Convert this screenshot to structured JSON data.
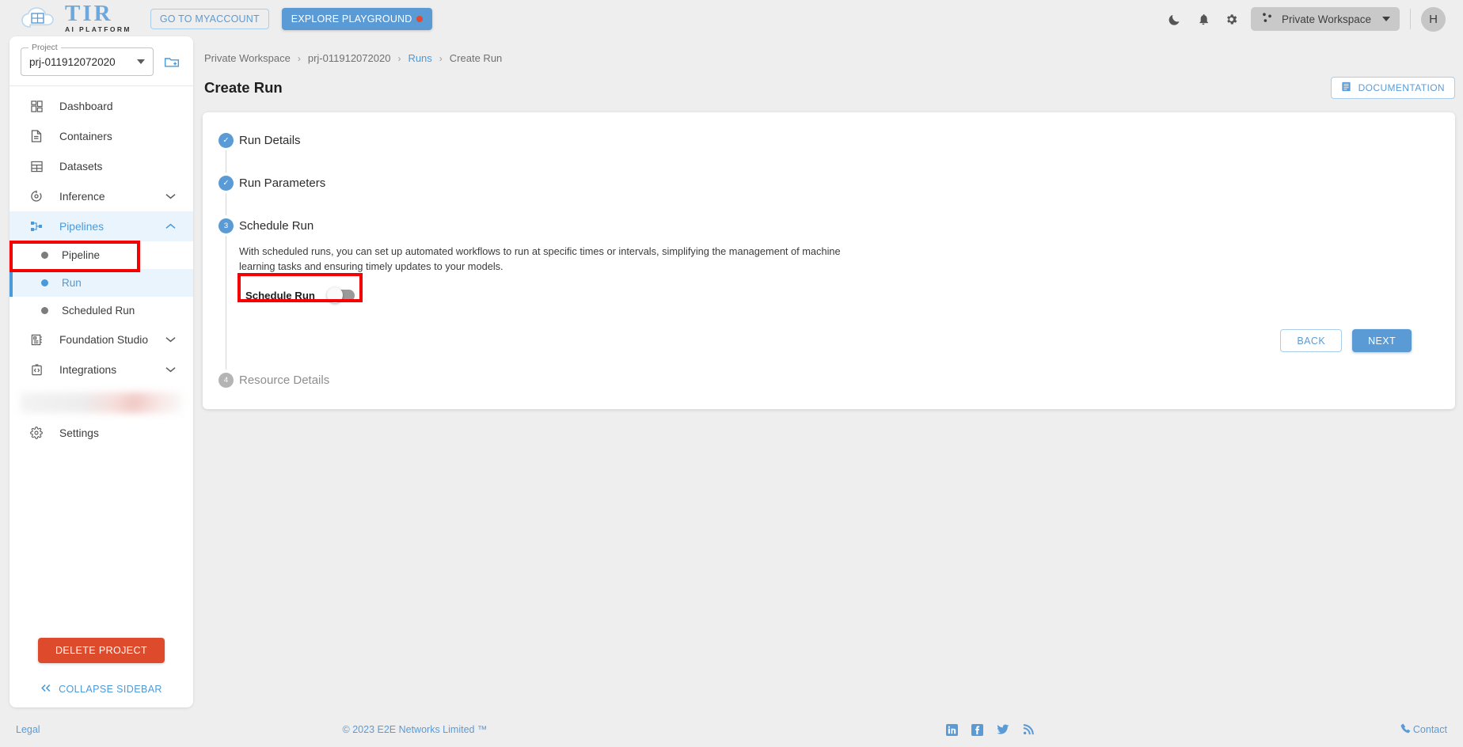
{
  "header": {
    "logo_title": "TIR",
    "logo_subtitle": "AI PLATFORM",
    "myaccount_label": "GO TO MYACCOUNT",
    "playground_label": "EXPLORE PLAYGROUND",
    "workspace_label": "Private Workspace",
    "avatar_initial": "H",
    "icons": {
      "dark_mode": "moon-icon",
      "notifications": "bell-icon",
      "settings": "gear-icon",
      "workspace": "workspace-nodes-icon",
      "caret": "chevron-down-icon"
    }
  },
  "sidebar": {
    "project": {
      "label": "Project",
      "value": "prj-011912072020",
      "add_icon": "new-project-folder-icon"
    },
    "nav": [
      {
        "label": "Dashboard",
        "icon": "dashboard-grid-icon",
        "expandable": false,
        "active": false
      },
      {
        "label": "Containers",
        "icon": "document-icon",
        "expandable": false,
        "active": false
      },
      {
        "label": "Datasets",
        "icon": "table-grid-icon",
        "expandable": false,
        "active": false
      },
      {
        "label": "Inference",
        "icon": "inference-target-icon",
        "expandable": true,
        "expanded": false,
        "active": false
      },
      {
        "label": "Pipelines",
        "icon": "pipelines-nodes-icon",
        "expandable": true,
        "expanded": true,
        "active": true
      }
    ],
    "pipelines_children": [
      {
        "label": "Pipeline",
        "active": false
      },
      {
        "label": "Run",
        "active": true
      },
      {
        "label": "Scheduled Run",
        "active": false
      }
    ],
    "nav_after": [
      {
        "label": "Foundation Studio",
        "icon": "foundation-studio-icon",
        "expandable": true,
        "expanded": false,
        "active": false
      },
      {
        "label": "Integrations",
        "icon": "integrations-code-icon",
        "expandable": true,
        "expanded": false,
        "active": false
      }
    ],
    "redacted_item": "",
    "settings": {
      "label": "Settings",
      "icon": "gear-icon"
    },
    "delete_project_label": "DELETE PROJECT",
    "collapse_label": "COLLAPSE SIDEBAR",
    "collapse_icon": "double-chevron-left-icon"
  },
  "main": {
    "breadcrumb": [
      {
        "label": "Private Workspace",
        "link": false
      },
      {
        "label": "prj-011912072020",
        "link": false
      },
      {
        "label": "Runs",
        "link": true
      },
      {
        "label": "Create Run",
        "link": false
      }
    ],
    "breadcrumb_separator": "›",
    "page_title": "Create Run",
    "documentation_label": "DOCUMENTATION",
    "documentation_icon": "book-icon",
    "steps": [
      {
        "number": "1",
        "title": "Run Details",
        "state": "done",
        "marker": "✓"
      },
      {
        "number": "2",
        "title": "Run Parameters",
        "state": "done",
        "marker": "✓"
      },
      {
        "number": "3",
        "title": "Schedule Run",
        "state": "current",
        "marker": "3"
      },
      {
        "number": "4",
        "title": "Resource Details",
        "state": "idle",
        "marker": "4"
      }
    ],
    "schedule": {
      "description": "With scheduled runs, you can set up automated workflows to run at specific times or intervals, simplifying the management of machine learning tasks and ensuring timely updates to your models.",
      "toggle_label": "Schedule Run",
      "toggle_state": "off"
    },
    "back_label": "BACK",
    "next_label": "NEXT"
  },
  "footer": {
    "legal": "Legal",
    "copyright": "© 2023 E2E Networks Limited ™",
    "social": [
      {
        "name": "linkedin-icon"
      },
      {
        "name": "facebook-icon"
      },
      {
        "name": "twitter-icon"
      },
      {
        "name": "rss-icon"
      }
    ],
    "contact": "Contact",
    "contact_icon": "phone-icon"
  },
  "colors": {
    "accent": "#5b9bd5",
    "danger": "#dd4b2c",
    "annotation": "#f50000",
    "background": "#eeeeee"
  }
}
